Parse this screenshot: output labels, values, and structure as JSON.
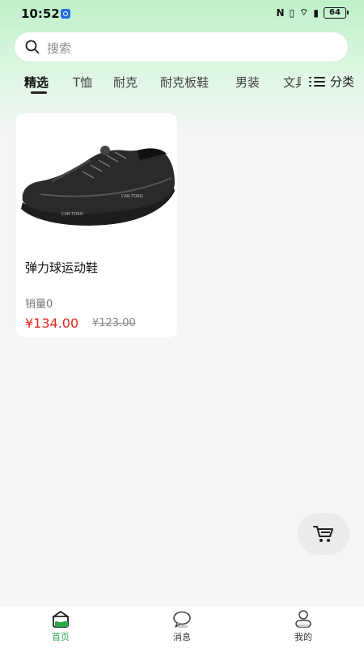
{
  "status_bar": {
    "time": "10:52",
    "nfc_glyph": "N",
    "vibrate_glyph": "▯",
    "signal_glyph": "⌔",
    "sim_glyph": "▮",
    "battery": "64"
  },
  "search": {
    "placeholder": "搜索"
  },
  "tabs": [
    {
      "label": "精选",
      "active": true
    },
    {
      "label": "T恤",
      "active": false
    },
    {
      "label": "耐克",
      "active": false
    },
    {
      "label": "耐克板鞋",
      "active": false
    },
    {
      "label": "男装",
      "active": false
    },
    {
      "label": "文具",
      "active": false
    }
  ],
  "category_button": {
    "label": "分类"
  },
  "products": [
    {
      "name": "弹力球运动鞋",
      "sales": "销量0",
      "price": "¥134.00",
      "original_price": "¥123.00"
    }
  ],
  "bottom_nav": [
    {
      "label": "首页",
      "active": true
    },
    {
      "label": "消息",
      "active": false
    },
    {
      "label": "我的",
      "active": false
    }
  ],
  "colors": {
    "accent": "#2aa84a",
    "price": "#e0261b"
  }
}
